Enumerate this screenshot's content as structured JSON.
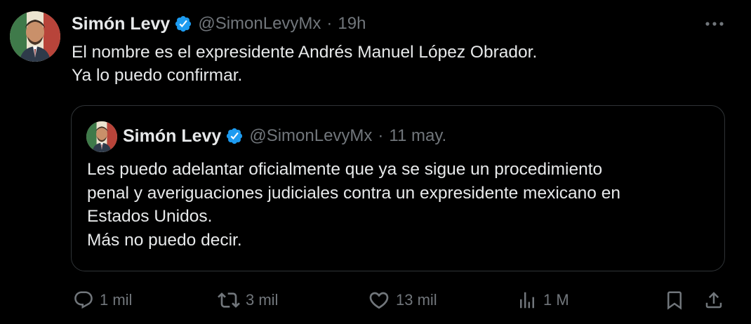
{
  "tweet": {
    "author_name": "Simón Levy",
    "handle": "@SimonLevyMx",
    "separator": "·",
    "time": "19h",
    "text_lines": [
      "El nombre es el expresidente Andrés Manuel López Obrador.",
      "Ya lo puedo confirmar."
    ],
    "avatar_icon": "profile-photo",
    "verified_icon": "verified-badge-icon",
    "verified_color": "#1d9bf0",
    "more_icon": "more-horizontal-icon"
  },
  "quoted_tweet": {
    "author_name": "Simón Levy",
    "handle": "@SimonLevyMx",
    "separator": "·",
    "time": "11 may.",
    "text_lines": [
      "Les puedo adelantar oficialmente que ya se sigue un procedimiento",
      "penal y averiguaciones judiciales contra un expresidente mexicano en",
      "Estados Unidos.",
      "Más no puedo decir."
    ]
  },
  "actions": {
    "reply_count": "1 mil",
    "retweet_count": "3 mil",
    "like_count": "13 mil",
    "views_count": "1 M"
  },
  "colors": {
    "background": "#000000",
    "text_primary": "#e7e9ea",
    "text_secondary": "#71767b",
    "border": "#2f3336"
  }
}
